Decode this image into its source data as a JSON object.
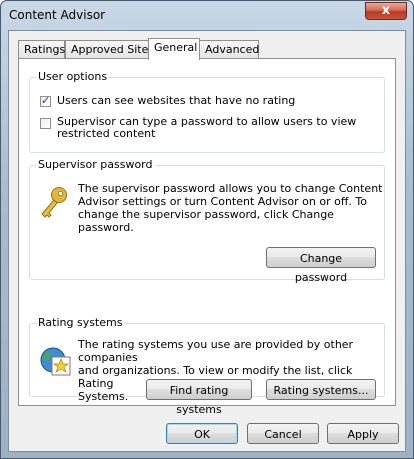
{
  "window": {
    "title": "Content Advisor",
    "close_glyph": "x"
  },
  "tabs": [
    "Ratings",
    "Approved Sites",
    "General",
    "Advanced"
  ],
  "active_tab": "General",
  "user_options": {
    "title": "User options",
    "checkbox1": {
      "label": "Users can see websites that have no rating",
      "checked": true
    },
    "checkbox2": {
      "label_line1": "Supervisor can type a password to allow users to view",
      "label_line2": "restricted content",
      "checked": false
    }
  },
  "supervisor": {
    "title": "Supervisor password",
    "desc_line1": "The supervisor password allows you to change Content",
    "desc_line2": "Advisor settings or turn Content Advisor on or off. To",
    "desc_line3": "change the supervisor password, click Change",
    "desc_line4": "password.",
    "button": "Change password",
    "icon": "key-icon"
  },
  "rating_systems": {
    "title": "Rating systems",
    "desc_line1": "The rating systems you use are provided by other companies",
    "desc_line2": "and organizations. To view or modify the list, click Rating",
    "desc_line3": "Systems.",
    "find_button": "Find rating systems",
    "systems_button": "Rating systems...",
    "icon": "globe-star-icon"
  },
  "footer": {
    "ok": "OK",
    "cancel": "Cancel",
    "apply": "Apply"
  }
}
